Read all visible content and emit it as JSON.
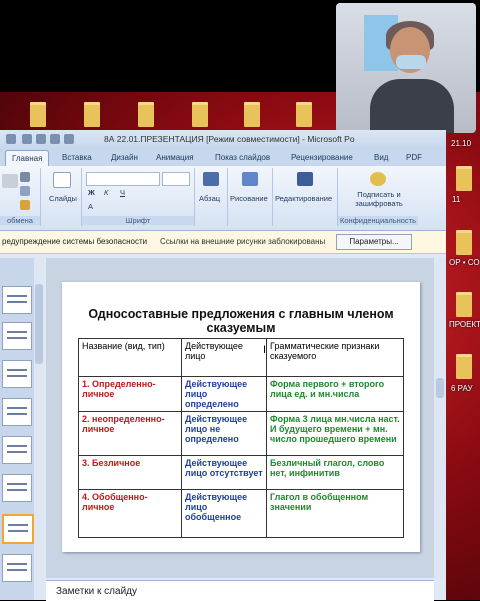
{
  "desktop": {
    "clock": "21.10",
    "icons": [
      "11",
      "ОР • СО",
      "ПРОЕКТ",
      "6 РАУ"
    ]
  },
  "window": {
    "title": "8А 22.01.ПРЕЗЕНТАЦИЯ [Режим совместимости] - Microsoft Po"
  },
  "ribbon": {
    "tabs": [
      "Главная",
      "Вставка",
      "Дизайн",
      "Анимация",
      "Показ слайдов",
      "Рецензирование",
      "Вид",
      "PDF"
    ],
    "groups": {
      "clipboard": "обмена",
      "slides_btn": "Слайды",
      "font": "Шрифт",
      "paragraph": "Абзац",
      "drawing": "Рисование",
      "editing": "Редактирование",
      "sign": "Подписать и зашифровать",
      "sign_group": "Конфиденциальность"
    }
  },
  "security_bar": {
    "warning": "редупреждение системы безопасности",
    "message": "Ссылки на внешние рисунки заблокированы",
    "button": "Параметры..."
  },
  "slide": {
    "title": "Односоставные предложения с главным членом сказуемым",
    "headers": [
      "Название (вид, тип)",
      "Действующее лицо",
      "Грамматические признаки сказуемого"
    ],
    "rows": [
      [
        "1. Определенно-личное",
        "Действующее лицо определено",
        "Форма первого + второго лица ед. и мн.числа"
      ],
      [
        "2. неопределенно-личное",
        "Действующее лицо  не определено",
        "Форма 3 лица мн.числа наст. И будущего времени + мн. число прошедшего времени"
      ],
      [
        "3. Безличное",
        "Действующее лицо отсутствует",
        "Безличный глагол, слово нет, инфинитив"
      ],
      [
        "4. Обобщенно-личное",
        "Действующее лицо обобщенное",
        "Глагол в обобщенном значении"
      ]
    ]
  },
  "notes": {
    "label": "Заметки к слайду"
  }
}
